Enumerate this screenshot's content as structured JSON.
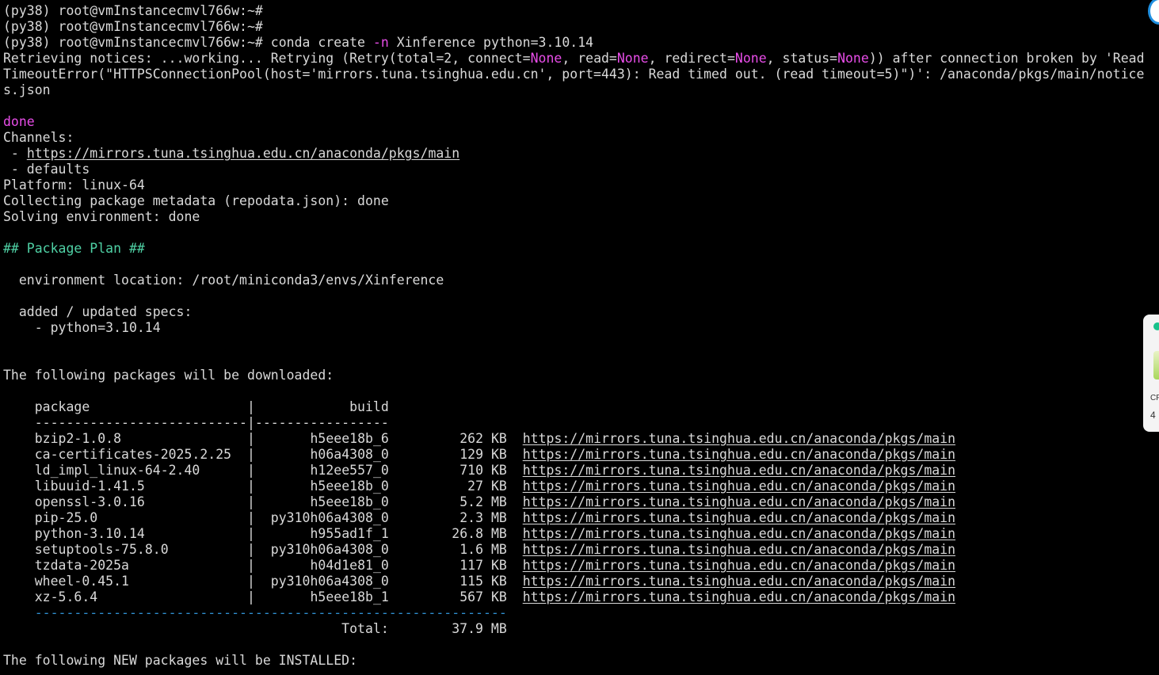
{
  "terminal": {
    "prompt_lines": [
      "(py38) root@vmInstancecmvl766w:~#",
      "(py38) root@vmInstancecmvl766w:~#"
    ],
    "command_prompt": "(py38) root@vmInstancecmvl766w:~#",
    "command": {
      "name": "conda",
      "sub": "create",
      "flag": "-n",
      "rest": "Xinference python=3.10.14"
    },
    "retrieving": {
      "prefix": "Retrieving notices: ...working... Retrying (Retry(total=2, connect=",
      "none1": "None",
      "mid1": ", read=",
      "none2": "None",
      "mid2": ", redirect=",
      "none3": "None",
      "mid3": ", status=",
      "none4": "None",
      "suffix": ")) after connection broken by 'Read",
      "line2": "TimeoutError(\"HTTPSConnectionPool(host='mirrors.tuna.tsinghua.edu.cn', port=443): Read timed out. (read timeout=5)\")': /anaconda/pkgs/main/notice",
      "line3": "s.json"
    },
    "done_label": "done",
    "channels_label": "Channels:",
    "channel_prefix": " - ",
    "channel_url": "https://mirrors.tuna.tsinghua.edu.cn/anaconda/pkgs/main",
    "channel_defaults": " - defaults",
    "platform": "Platform: linux-64",
    "collecting": "Collecting package metadata (repodata.json): done",
    "solving": "Solving environment: done",
    "package_plan": "## Package Plan ##",
    "env_location": "  environment location: /root/miniconda3/envs/Xinference",
    "added_specs": "  added / updated specs:",
    "spec_item": "    - python=3.10.14",
    "download_heading": "The following packages will be downloaded:",
    "table_header": "    package                    |            build",
    "table_rule": "    ---------------------------|-----------------",
    "packages": [
      {
        "name": "bzip2-1.0.8",
        "build": "h5eee18b_6",
        "size": "262 KB",
        "url": "https://mirrors.tuna.tsinghua.edu.cn/anaconda/pkgs/main"
      },
      {
        "name": "ca-certificates-2025.2.25",
        "build": "h06a4308_0",
        "size": "129 KB",
        "url": "https://mirrors.tuna.tsinghua.edu.cn/anaconda/pkgs/main"
      },
      {
        "name": "ld_impl_linux-64-2.40",
        "build": "h12ee557_0",
        "size": "710 KB",
        "url": "https://mirrors.tuna.tsinghua.edu.cn/anaconda/pkgs/main"
      },
      {
        "name": "libuuid-1.41.5",
        "build": "h5eee18b_0",
        "size": "27 KB",
        "url": "https://mirrors.tuna.tsinghua.edu.cn/anaconda/pkgs/main"
      },
      {
        "name": "openssl-3.0.16",
        "build": "h5eee18b_0",
        "size": "5.2 MB",
        "url": "https://mirrors.tuna.tsinghua.edu.cn/anaconda/pkgs/main"
      },
      {
        "name": "pip-25.0",
        "build": "py310h06a4308_0",
        "size": "2.3 MB",
        "url": "https://mirrors.tuna.tsinghua.edu.cn/anaconda/pkgs/main"
      },
      {
        "name": "python-3.10.14",
        "build": "h955ad1f_1",
        "size": "26.8 MB",
        "url": "https://mirrors.tuna.tsinghua.edu.cn/anaconda/pkgs/main"
      },
      {
        "name": "setuptools-75.8.0",
        "build": "py310h06a4308_0",
        "size": "1.6 MB",
        "url": "https://mirrors.tuna.tsinghua.edu.cn/anaconda/pkgs/main"
      },
      {
        "name": "tzdata-2025a",
        "build": "h04d1e81_0",
        "size": "117 KB",
        "url": "https://mirrors.tuna.tsinghua.edu.cn/anaconda/pkgs/main"
      },
      {
        "name": "wheel-0.45.1",
        "build": "py310h06a4308_0",
        "size": "115 KB",
        "url": "https://mirrors.tuna.tsinghua.edu.cn/anaconda/pkgs/main"
      },
      {
        "name": "xz-5.6.4",
        "build": "h5eee18b_1",
        "size": "567 KB",
        "url": "https://mirrors.tuna.tsinghua.edu.cn/anaconda/pkgs/main"
      }
    ],
    "total_rule": "    ------------------------------------------------------------",
    "total_label": "                                           Total:",
    "total_value": "37.9 MB",
    "new_packages_heading": "The following NEW packages will be INSTALLED:"
  },
  "edge_widget": {
    "text1": "CP",
    "text2": "4"
  },
  "colors": {
    "background": "#000000",
    "foreground": "#d9d9d9",
    "highlight_magenta": "#e84de8",
    "heading_green": "#4fd1a5",
    "rule_blue": "#2f8fd0"
  }
}
